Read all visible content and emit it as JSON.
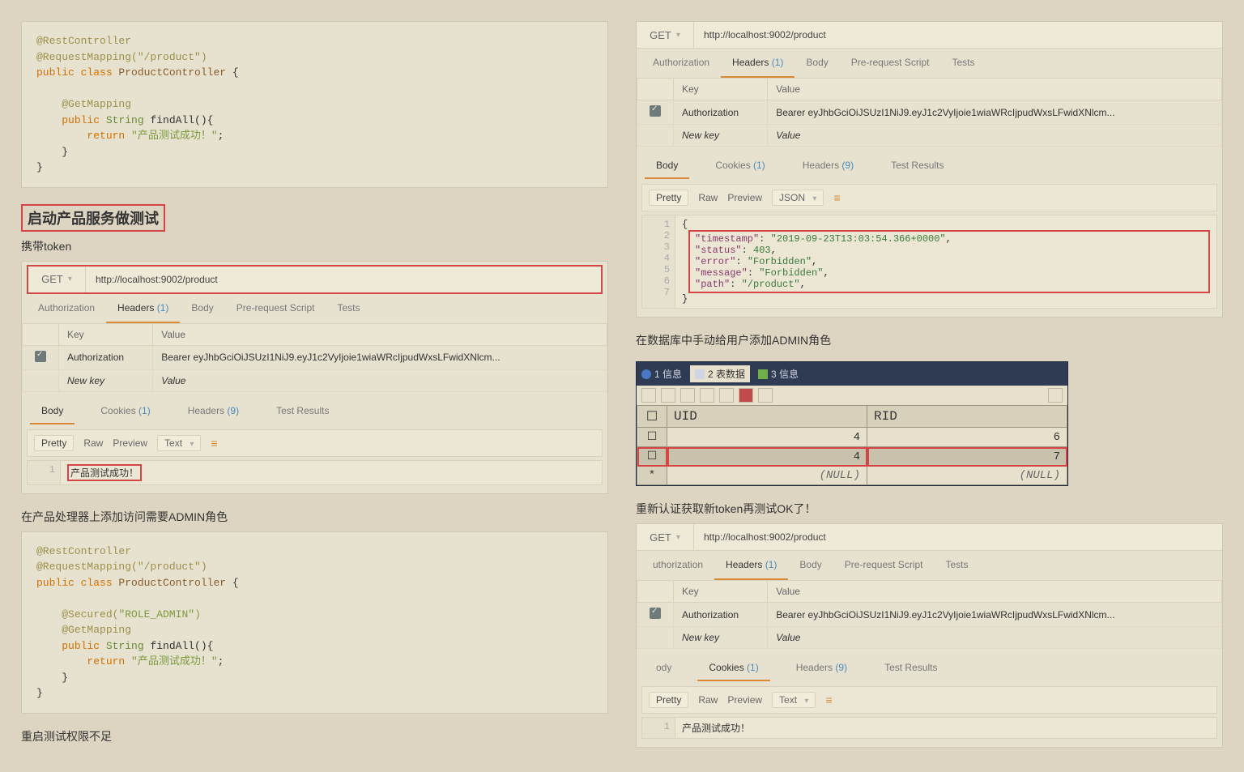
{
  "leftCol": {
    "code1_lines": [
      {
        "cls": "anno",
        "t": "@RestController"
      },
      {
        "cls": "anno",
        "t": "@RequestMapping(\"/product\")"
      },
      {
        "pre": "",
        "segs": [
          {
            "c": "kw",
            "t": "public class "
          },
          {
            "c": "pkg",
            "t": "ProductController"
          },
          {
            "c": "",
            "t": " {"
          }
        ]
      },
      {
        "t": ""
      },
      {
        "pre": "    ",
        "segs": [
          {
            "c": "anno",
            "t": "@GetMapping"
          }
        ]
      },
      {
        "pre": "    ",
        "segs": [
          {
            "c": "kw",
            "t": "public "
          },
          {
            "c": "typ",
            "t": "String"
          },
          {
            "c": "",
            "t": " findAll(){"
          }
        ]
      },
      {
        "pre": "        ",
        "segs": [
          {
            "c": "kw",
            "t": "return "
          },
          {
            "c": "str",
            "t": "\"产品测试成功！\""
          },
          {
            "c": "",
            "t": ";"
          }
        ]
      },
      {
        "pre": "    ",
        "t": "}"
      },
      {
        "t": "}"
      }
    ],
    "heading1": "启动产品服务做测试",
    "sub1": "携带token",
    "postman1": {
      "method": "GET",
      "url": "http://localhost:9002/product",
      "tabs": [
        {
          "l": "Authorization"
        },
        {
          "l": "Headers",
          "cnt": "(1)",
          "active": true
        },
        {
          "l": "Body"
        },
        {
          "l": "Pre-request Script"
        },
        {
          "l": "Tests"
        }
      ],
      "cols": {
        "key": "Key",
        "val": "Value"
      },
      "row": {
        "key": "Authorization",
        "val": "Bearer eyJhbGciOiJSUzI1NiJ9.eyJ1c2VyIjoie1wiaWRcIjpudWxsLFwidXNlcm..."
      },
      "new_key": "New key",
      "new_val": "Value",
      "bodytabs": [
        {
          "l": "Body",
          "active": true
        },
        {
          "l": "Cookies",
          "cnt": "(1)"
        },
        {
          "l": "Headers",
          "cnt": "(9)"
        },
        {
          "l": "Test Results"
        }
      ],
      "fmt": {
        "pretty": "Pretty",
        "raw": "Raw",
        "preview": "Preview",
        "type": "Text"
      },
      "out": "产品测试成功！"
    },
    "heading2": "在产品处理器上添加访问需要ADMIN角色",
    "code2_lines": [
      {
        "cls": "anno",
        "t": "@RestController"
      },
      {
        "cls": "anno",
        "t": "@RequestMapping(\"/product\")"
      },
      {
        "pre": "",
        "segs": [
          {
            "c": "kw",
            "t": "public class "
          },
          {
            "c": "pkg",
            "t": "ProductController"
          },
          {
            "c": "",
            "t": " {"
          }
        ]
      },
      {
        "t": ""
      },
      {
        "pre": "    ",
        "segs": [
          {
            "c": "anno",
            "t": "@Secured("
          },
          {
            "c": "str",
            "t": "\"ROLE_ADMIN\""
          },
          {
            "c": "anno",
            "t": ")"
          }
        ]
      },
      {
        "pre": "    ",
        "segs": [
          {
            "c": "anno",
            "t": "@GetMapping"
          }
        ]
      },
      {
        "pre": "    ",
        "segs": [
          {
            "c": "kw",
            "t": "public "
          },
          {
            "c": "typ",
            "t": "String"
          },
          {
            "c": "",
            "t": " findAll(){"
          }
        ]
      },
      {
        "pre": "        ",
        "segs": [
          {
            "c": "kw",
            "t": "return "
          },
          {
            "c": "str",
            "t": "\"产品测试成功！\""
          },
          {
            "c": "",
            "t": ";"
          }
        ]
      },
      {
        "pre": "    ",
        "t": "}"
      },
      {
        "t": "}"
      }
    ],
    "heading3": "重启测试权限不足"
  },
  "rightCol": {
    "postman2": {
      "method": "GET",
      "url": "http://localhost:9002/product",
      "tabs": [
        {
          "l": "Authorization"
        },
        {
          "l": "Headers",
          "cnt": "(1)",
          "active": true
        },
        {
          "l": "Body"
        },
        {
          "l": "Pre-request Script"
        },
        {
          "l": "Tests"
        }
      ],
      "cols": {
        "key": "Key",
        "val": "Value"
      },
      "row": {
        "key": "Authorization",
        "val": "Bearer eyJhbGciOiJSUzI1NiJ9.eyJ1c2VyIjoie1wiaWRcIjpudWxsLFwidXNlcm..."
      },
      "new_key": "New key",
      "new_val": "Value",
      "bodytabs": [
        {
          "l": "Body",
          "active": true
        },
        {
          "l": "Cookies",
          "cnt": "(1)"
        },
        {
          "l": "Headers",
          "cnt": "(9)"
        },
        {
          "l": "Test Results"
        }
      ],
      "fmt": {
        "pretty": "Pretty",
        "raw": "Raw",
        "preview": "Preview",
        "type": "JSON"
      },
      "json": [
        {
          "n": "1",
          "t": "{"
        },
        {
          "n": "2",
          "k": "timestamp",
          "v": "\"2019-09-23T13:03:54.366+0000\""
        },
        {
          "n": "3",
          "k": "status",
          "v": "403",
          "num": true
        },
        {
          "n": "4",
          "k": "error",
          "v": "\"Forbidden\""
        },
        {
          "n": "5",
          "k": "message",
          "v": "\"Forbidden\""
        },
        {
          "n": "6",
          "k": "path",
          "v": "\"/product\""
        },
        {
          "n": "7",
          "t": "}"
        }
      ]
    },
    "heading4": "在数据库中手动给用户添加ADMIN角色",
    "db": {
      "tabs": [
        {
          "l": "1 信息"
        },
        {
          "l": "2 表数据",
          "active": true
        },
        {
          "l": "3 信息"
        }
      ],
      "cols": [
        "UID",
        "RID"
      ],
      "rows": [
        {
          "uid": "4",
          "rid": "6"
        },
        {
          "uid": "4",
          "rid": "7",
          "red": true
        },
        {
          "uid": "(NULL)",
          "rid": "(NULL)",
          "star": true,
          "null": true
        }
      ]
    },
    "heading5": "重新认证获取新token再测试OK了！",
    "postman3": {
      "method": "GET",
      "url": "http://localhost:9002/product",
      "tabs": [
        {
          "l": "uthorization"
        },
        {
          "l": "Headers",
          "cnt": "(1)",
          "active": true
        },
        {
          "l": "Body"
        },
        {
          "l": "Pre-request Script"
        },
        {
          "l": "Tests"
        }
      ],
      "cols": {
        "key": "Key",
        "val": "Value"
      },
      "row": {
        "key": "Authorization",
        "val": "Bearer eyJhbGciOiJSUzI1NiJ9.eyJ1c2VyIjoie1wiaWRcIjpudWxsLFwidXNlcm..."
      },
      "new_key": "New key",
      "new_val": "Value",
      "bodytabs": [
        {
          "l": "ody"
        },
        {
          "l": "Cookies",
          "cnt": "(1)",
          "active": true
        },
        {
          "l": "Headers",
          "cnt": "(9)"
        },
        {
          "l": "Test Results"
        }
      ],
      "fmt": {
        "pretty": "Pretty",
        "raw": "Raw",
        "preview": "Preview",
        "type": "Text"
      },
      "out": "产品测试成功！"
    }
  }
}
